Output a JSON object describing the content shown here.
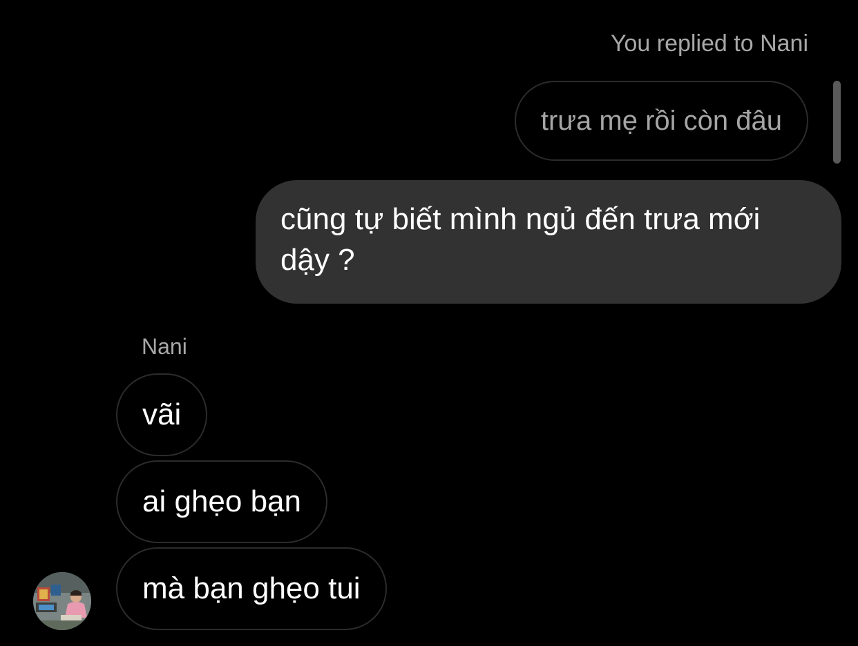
{
  "thread": {
    "reply_caption": "You replied to Nani",
    "quoted_message": "trưa mẹ rồi còn đâu",
    "outgoing_message": "cũng tự biết mình ngủ đến trưa mới dậy ?",
    "sender_name": "Nani",
    "incoming_messages": [
      "vãi",
      "ai ghẹo bạn",
      "mà bạn ghẹo tui"
    ],
    "avatar_icon": "profile-photo-avatar"
  },
  "colors": {
    "background": "#000000",
    "outgoing_bubble": "#323232",
    "incoming_border": "#2c2c2c",
    "secondary_text": "#a8a8a8",
    "primary_text": "#ffffff"
  }
}
